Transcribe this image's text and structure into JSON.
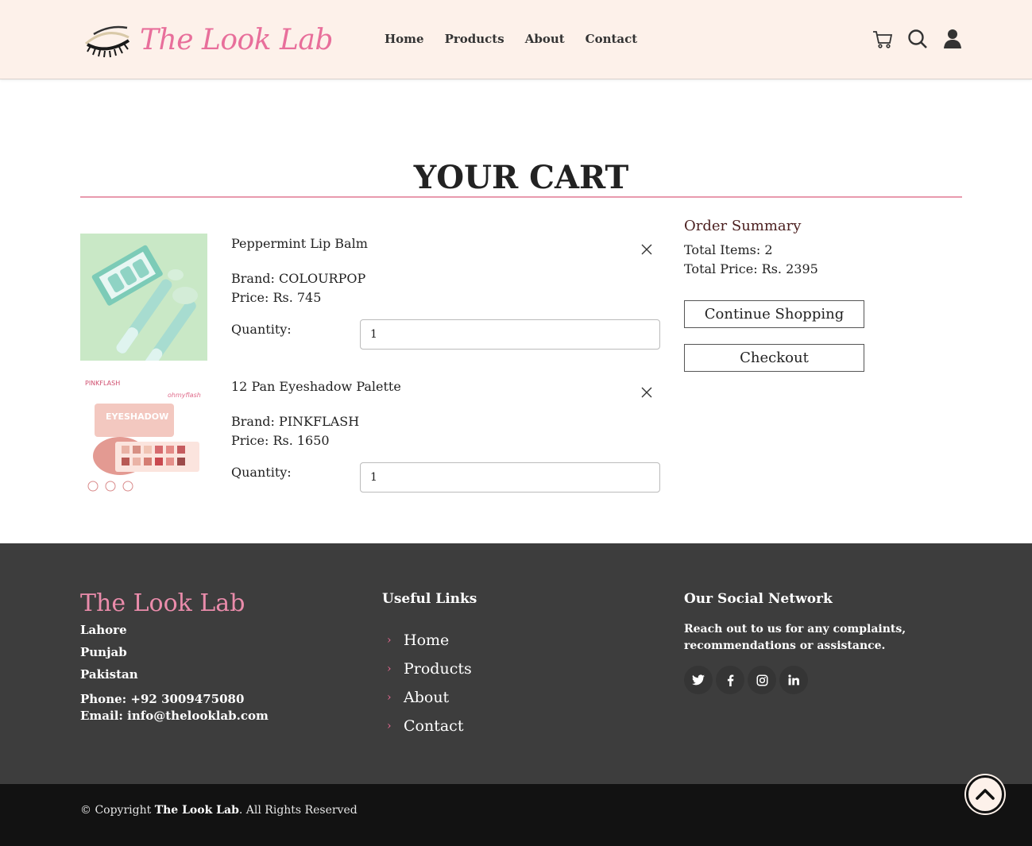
{
  "header": {
    "brand": "The Look Lab",
    "nav": [
      "Home",
      "Products",
      "About",
      "Contact"
    ],
    "icons": [
      "cart-icon",
      "search-icon",
      "user-icon"
    ]
  },
  "cart": {
    "title": "YOUR CART",
    "items": [
      {
        "name": "Peppermint Lip Balm",
        "brand": "Brand: COLOURPOP",
        "price": "Price: Rs. 745",
        "quantity_label": "Quantity:",
        "quantity": "1"
      },
      {
        "name": "12 Pan Eyeshadow Palette",
        "brand": "Brand: PINKFLASH",
        "price": "Price: Rs. 1650",
        "quantity_label": "Quantity:",
        "quantity": "1",
        "image_text": {
          "maker": "PINKFLASH",
          "label": "EYESHADOW",
          "tag": "ohmyflash"
        }
      }
    ]
  },
  "summary": {
    "title": "Order Summary",
    "total_items": "Total Items: 2",
    "total_price": "Total Price: Rs. 2395",
    "continue_label": "Continue Shopping",
    "checkout_label": "Checkout"
  },
  "footer": {
    "brand": "The Look Lab",
    "address": [
      "Lahore",
      "Punjab",
      "Pakistan"
    ],
    "phone": "Phone: +92 3009475080",
    "email": "Email: info@thelooklab.com",
    "links_heading": "Useful Links",
    "links": [
      "Home",
      "Products",
      "About",
      "Contact"
    ],
    "social_heading": "Our Social Network",
    "social_desc": "Reach out to us for any complaints, recommendations or assistance.",
    "social_icons": [
      "twitter-icon",
      "facebook-icon",
      "instagram-icon",
      "linkedin-icon"
    ]
  },
  "bottom": {
    "copyright_prefix": "© Copyright",
    "copyright_brand": "The Look Lab",
    "copyright_suffix": ". All Rights Reserved"
  },
  "colors": {
    "brand_pink": "#e86f9b",
    "header_bg": "#fdf1ea",
    "footer_bg": "#3d3d3d",
    "bottom_bg": "#121212"
  }
}
